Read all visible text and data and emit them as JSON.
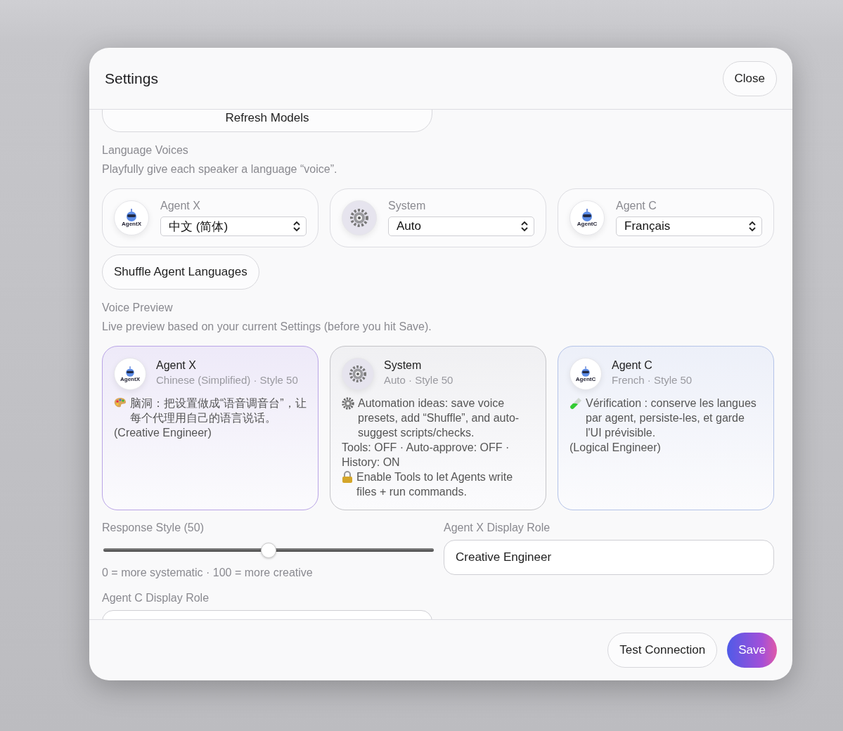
{
  "dialog": {
    "title": "Settings",
    "close_button": "Close"
  },
  "refresh_button": "Refresh Models",
  "language_voices": {
    "title": "Language Voices",
    "description": "Playfully give each speaker a language “voice”.",
    "agents": [
      {
        "kind": "agent",
        "name": "Agent X",
        "avatar_label": "AgentX",
        "value": "中文 (简体)"
      },
      {
        "kind": "system",
        "name": "System",
        "value": "Auto"
      },
      {
        "kind": "agent",
        "name": "Agent C",
        "avatar_label": "AgentC",
        "value": "Français"
      }
    ],
    "shuffle_button": "Shuffle Agent Languages"
  },
  "voice_preview": {
    "title": "Voice Preview",
    "description": "Live preview based on your current Settings (before you hit Save).",
    "cards": [
      {
        "kind": "agent",
        "color": "#b9a4e6",
        "name": "Agent X",
        "avatar_label": "AgentX",
        "subtitle": "Chinese (Simplified) · Style 50",
        "lines": [
          {
            "kind": "idea",
            "text": "脑洞：把设置做成“语音调音台”，让每个代理用自己的语言说话。"
          },
          {
            "kind": "plain",
            "text": "(Creative Engineer)"
          }
        ]
      },
      {
        "kind": "system",
        "color": "#c4c4c8",
        "name": "System",
        "subtitle": "Auto · Style 50",
        "lines": [
          {
            "kind": "automation",
            "text": "Automation ideas: save voice presets, add “Shuffle”, and auto-suggest scripts/checks."
          },
          {
            "kind": "plain",
            "text": "Tools: OFF · Auto-approve: OFF · History: ON"
          },
          {
            "kind": "notice",
            "text": "Enable Tools to let Agents write files + run commands."
          }
        ]
      },
      {
        "kind": "agent",
        "color": "#b4c3e8",
        "name": "Agent C",
        "avatar_label": "AgentC",
        "subtitle": "French · Style 50",
        "lines": [
          {
            "kind": "check",
            "text": "Vérification : conserve les langues par agent, persiste-les, et garde l'UI prévisible."
          },
          {
            "kind": "plain",
            "text": "(Logical Engineer)"
          }
        ]
      }
    ]
  },
  "response_style": {
    "label": "Response Style (50)",
    "level": 0.5,
    "hint": "0 = more systematic · 100 = more creative"
  },
  "agent_x_role": {
    "label": "Agent X Display Role",
    "value": "Creative Engineer"
  },
  "agent_c_role": {
    "label": "Agent C Display Role"
  },
  "footer": {
    "test_button": "Test Connection",
    "save_button": "Save"
  }
}
